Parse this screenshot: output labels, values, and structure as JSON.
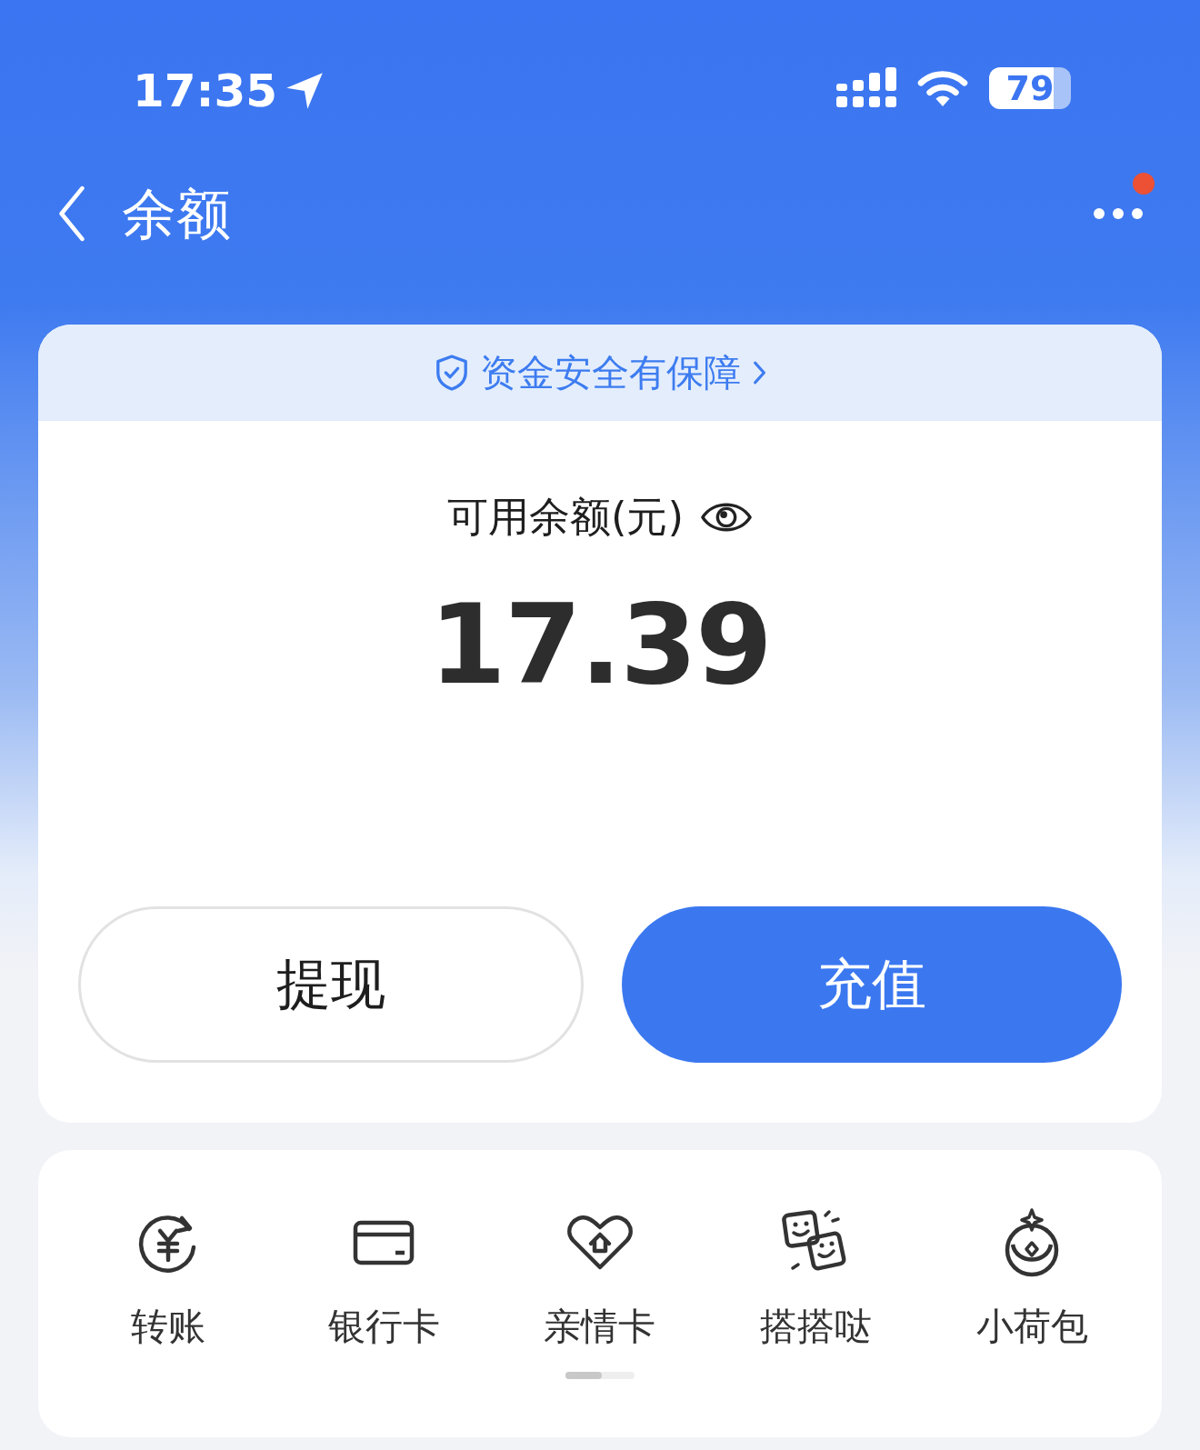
{
  "status_bar": {
    "time": "17:35",
    "battery": "79"
  },
  "nav": {
    "title": "余额",
    "notification": true
  },
  "balance_card": {
    "security_banner": "资金安全有保障",
    "label": "可用余额(元)",
    "amount": "17.39",
    "buttons": [
      {
        "label": "提现",
        "kind": "secondary"
      },
      {
        "label": "充值",
        "kind": "primary"
      }
    ]
  },
  "shortcuts": [
    {
      "label": "转账"
    },
    {
      "label": "银行卡"
    },
    {
      "label": "亲情卡"
    },
    {
      "label": "搭搭哒"
    },
    {
      "label": "小荷包"
    }
  ]
}
